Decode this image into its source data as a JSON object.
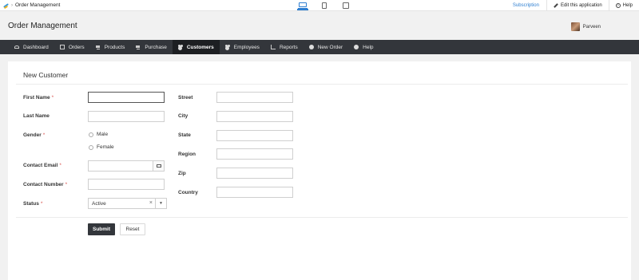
{
  "topbar": {
    "crumb": "Order Management",
    "subscription": "Subscription",
    "edit": "Edit this application",
    "help": "Help"
  },
  "app": {
    "title": "Order Management",
    "user": "Parveen"
  },
  "nav": [
    {
      "label": "Dashboard",
      "icon": "dashboard-icon"
    },
    {
      "label": "Orders",
      "icon": "edit-icon"
    },
    {
      "label": "Products",
      "icon": "cart-icon"
    },
    {
      "label": "Purchase",
      "icon": "cart-icon"
    },
    {
      "label": "Customers",
      "icon": "users-icon",
      "active": true
    },
    {
      "label": "Employees",
      "icon": "users-icon"
    },
    {
      "label": "Reports",
      "icon": "chart-icon"
    },
    {
      "label": "New Order",
      "icon": "plus-circle-icon"
    },
    {
      "label": "Help",
      "icon": "info-icon"
    }
  ],
  "form": {
    "title": "New Customer",
    "first_name": "First Name",
    "last_name": "Last Name",
    "gender": "Gender",
    "male": "Male",
    "female": "Female",
    "contact_email": "Contact Email",
    "contact_number": "Contact Number",
    "status": "Status",
    "status_value": "Active",
    "street": "Street",
    "city": "City",
    "state": "State",
    "region": "Region",
    "zip": "Zip",
    "country": "Country",
    "required_mark": "*",
    "clear_mark": "×",
    "arrow_mark": "▼",
    "submit": "Submit",
    "reset": "Reset"
  },
  "colors": {
    "nav_bg": "#33363b",
    "nav_active": "#1d1f22",
    "accent": "#2f7fd1",
    "required": "#d9534f"
  }
}
